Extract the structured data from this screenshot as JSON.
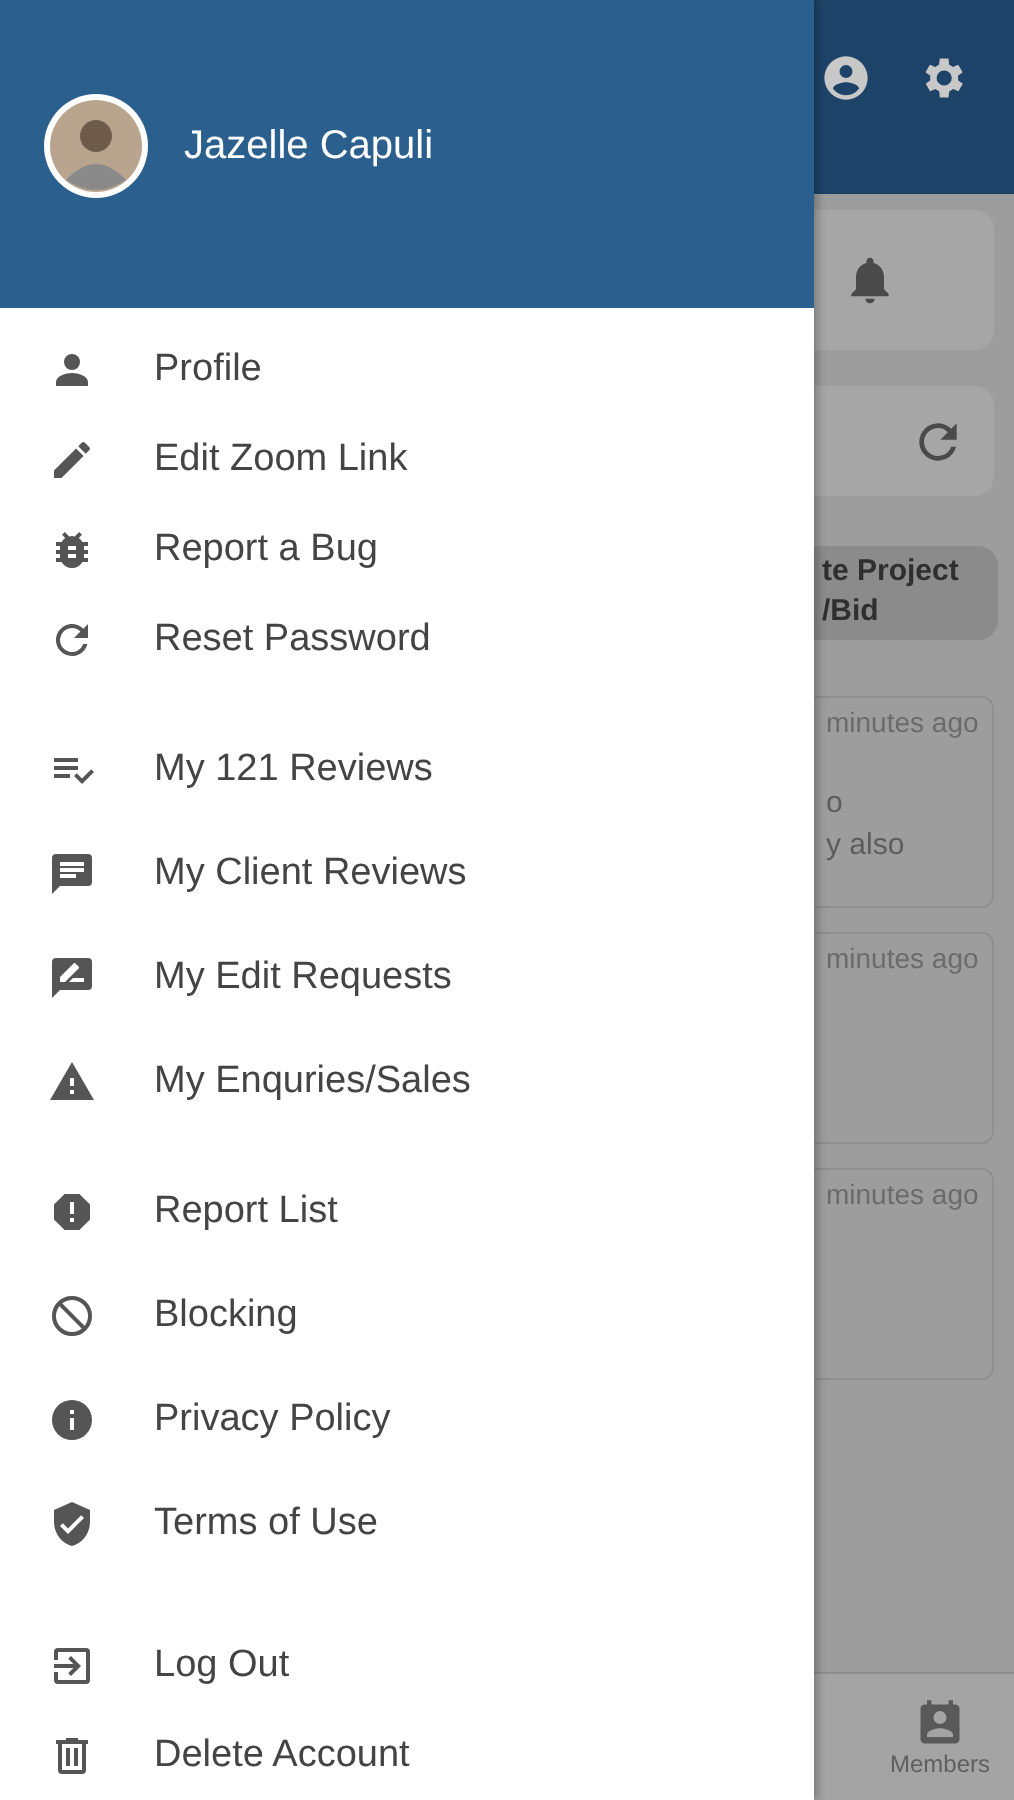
{
  "drawer": {
    "user_name": "Jazelle Capuli",
    "sections": [
      [
        {
          "label": "Profile"
        },
        {
          "label": "Edit Zoom Link"
        },
        {
          "label": "Report a Bug"
        },
        {
          "label": "Reset Password"
        }
      ],
      [
        {
          "label": "My 121 Reviews"
        },
        {
          "label": "My Client Reviews"
        },
        {
          "label": "My Edit Requests"
        },
        {
          "label": "My Enquries/Sales"
        }
      ],
      [
        {
          "label": "Report List"
        },
        {
          "label": "Blocking"
        },
        {
          "label": "Privacy Policy"
        },
        {
          "label": "Terms of Use"
        }
      ],
      [
        {
          "label": "Log Out"
        },
        {
          "label": "Delete Account"
        }
      ]
    ]
  },
  "background": {
    "action_button": [
      "te Project",
      "/Bid"
    ],
    "cards": [
      {
        "time": "minutes ago",
        "lines": [
          "o",
          "y also"
        ]
      },
      {
        "time": "minutes ago"
      },
      {
        "time": "minutes ago"
      }
    ],
    "bottom_nav": [
      {
        "label": "Members"
      }
    ]
  }
}
